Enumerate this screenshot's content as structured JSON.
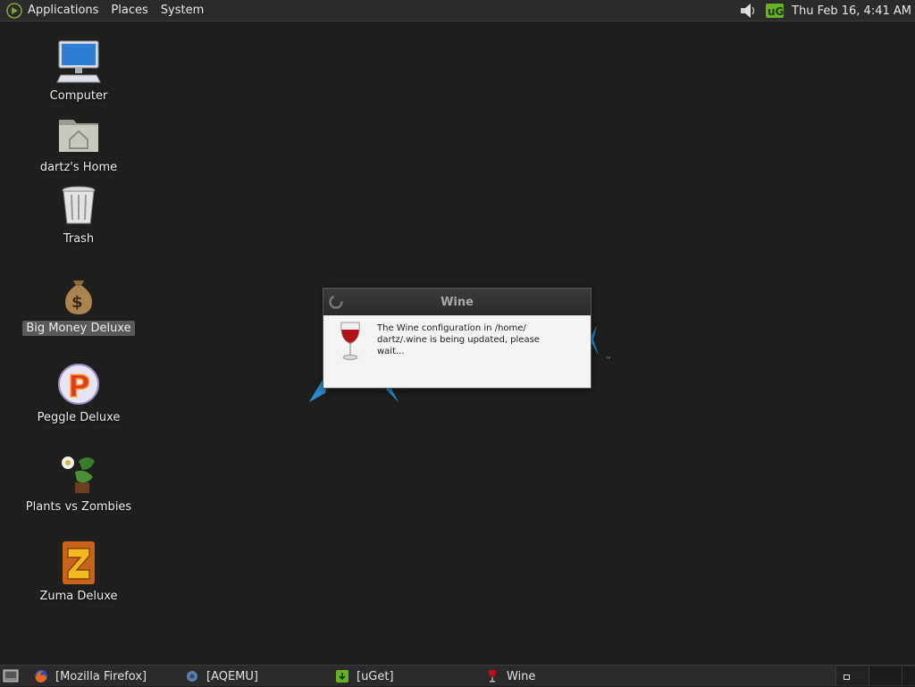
{
  "top_panel": {
    "menus": [
      "Applications",
      "Places",
      "System"
    ],
    "clock": "Thu Feb 16,  4:41 AM",
    "tray_icons": [
      "volume-icon",
      "uget-tray-icon"
    ]
  },
  "desktop": {
    "icons": [
      {
        "label": "Computer",
        "icon": "computer-icon"
      },
      {
        "label": "dartz's Home",
        "icon": "home-folder-icon"
      },
      {
        "label": "Trash",
        "icon": "trash-icon"
      },
      {
        "label": "Big Money Deluxe",
        "icon": "money-bag-icon",
        "selected": true
      },
      {
        "label": "Peggle Deluxe",
        "icon": "peggle-icon"
      },
      {
        "label": "Plants vs Zombies",
        "icon": "plants-vs-zombies-icon"
      },
      {
        "label": "Zuma Deluxe",
        "icon": "zuma-icon"
      }
    ]
  },
  "dialog": {
    "title": "Wine",
    "message": "The Wine configuration in /home/ dartz/.wine is being updated, please wait..."
  },
  "taskbar": {
    "tasks": [
      {
        "label": "[Mozilla Firefox]",
        "icon": "firefox-icon"
      },
      {
        "label": "[AQEMU]",
        "icon": "aqemu-icon"
      },
      {
        "label": "[uGet]",
        "icon": "uget-icon"
      },
      {
        "label": "Wine",
        "icon": "wine-icon"
      }
    ]
  },
  "colors": {
    "desktop_bg": "#1f201e",
    "panel_bg": "#2b2b2b",
    "accent_green": "#6ab023",
    "logo_blue": "#2a8fd1"
  }
}
